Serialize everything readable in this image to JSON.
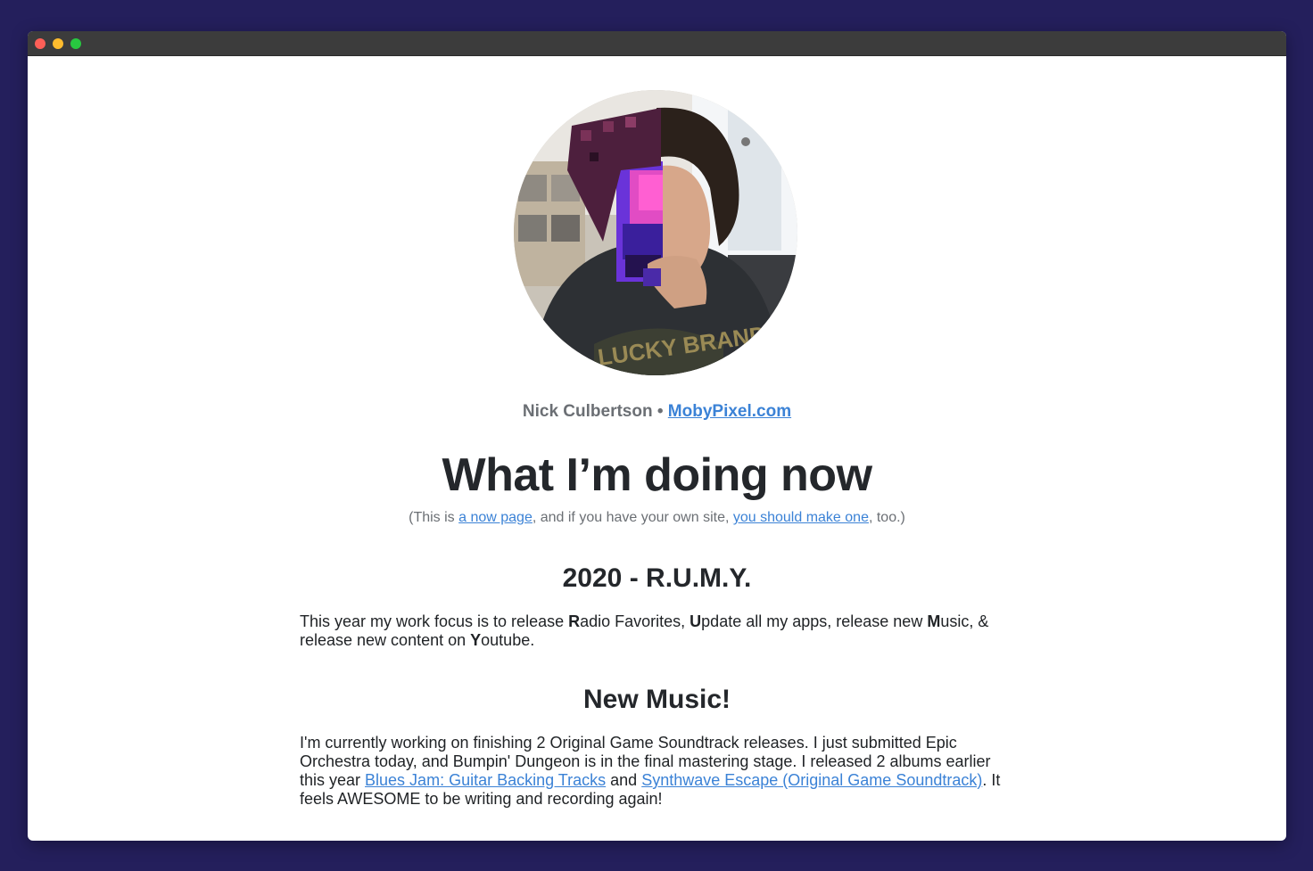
{
  "window": {
    "title_dots": [
      "close",
      "minimize",
      "maximize"
    ]
  },
  "profile": {
    "avatar_alt": "Nick Culbertson",
    "name": "Nick Culbertson",
    "separator": "•",
    "site_link": "MobyPixel.com"
  },
  "header": {
    "title": "What I’m doing now",
    "sub_prefix": "(This is ",
    "sub_link1": "a now page",
    "sub_mid": ", and if you have your own site, ",
    "sub_link2": "you should make one",
    "sub_suffix": ", too.)"
  },
  "sections": [
    {
      "heading": "2020 - R.U.M.Y.",
      "p_a": "This year my work focus is to release ",
      "b1": "R",
      "p_b": "adio Favorites, ",
      "b2": "U",
      "p_c": "pdate all my apps, release new ",
      "b3": "M",
      "p_d": "usic, & release new content on ",
      "b4": "Y",
      "p_e": "outube."
    },
    {
      "heading": "New Music!",
      "p_a": "I'm currently working on finishing 2 Original Game Soundtrack releases. I just submitted Epic Orchestra today, and Bumpin' Dungeon is in the final mastering stage. I released 2 albums earlier this year ",
      "link1": "Blues Jam: Guitar Backing Tracks",
      "p_b": " and ",
      "link2": "Synthwave Escape (Original Game Soundtrack)",
      "p_c": ". It feels AWESOME to be writing and recording again!"
    }
  ],
  "colors": {
    "background": "#241f5c",
    "link": "#3b82d6",
    "heading": "#24272b",
    "muted": "#6b6f74"
  }
}
